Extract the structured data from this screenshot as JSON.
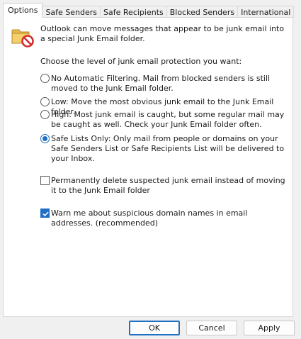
{
  "tabs": [
    {
      "label": "Options"
    },
    {
      "label": "Safe Senders"
    },
    {
      "label": "Safe Recipients"
    },
    {
      "label": "Blocked Senders"
    },
    {
      "label": "International"
    }
  ],
  "intro": "Outlook can move messages that appear to be junk email into a special Junk Email folder.",
  "prompt": "Choose the level of junk email protection you want:",
  "levels": [
    {
      "label": "No Automatic Filtering. Mail from blocked senders is still moved to the Junk Email folder.",
      "selected": false
    },
    {
      "label": "Low: Move the most obvious junk email to the Junk Email folder.",
      "selected": false
    },
    {
      "label": "High: Most junk email is caught, but some regular mail may be caught as well. Check your Junk Email folder often.",
      "selected": false
    },
    {
      "label": "Safe Lists Only: Only mail from people or domains on your Safe Senders List or Safe Recipients List will be delivered to your Inbox.",
      "selected": true
    }
  ],
  "options": {
    "permanent_delete": {
      "label": "Permanently delete suspected junk email instead of moving it to the Junk Email folder",
      "checked": false
    },
    "warn_domains": {
      "label": "Warn me about suspicious domain names in email addresses. (recommended)",
      "checked": true
    }
  },
  "buttons": {
    "ok": "OK",
    "cancel": "Cancel",
    "apply": "Apply"
  },
  "colors": {
    "accent": "#1f6fc4",
    "icon_stop": "#d32f2f",
    "icon_folder": "#e8b84a"
  },
  "icon": "junk-folder-blocked-icon"
}
